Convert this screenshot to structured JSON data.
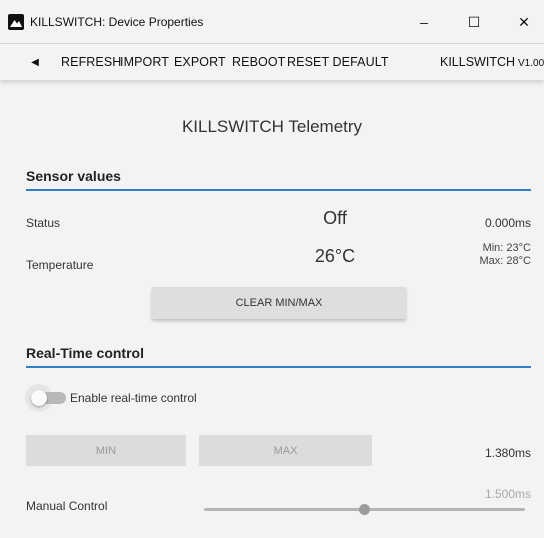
{
  "window": {
    "title": "KILLSWITCH: Device Properties",
    "app_icon": "mountain-logo-icon",
    "minimize_glyph": "–",
    "maximize_glyph": "☐",
    "close_glyph": "✕"
  },
  "toolbar": {
    "back_glyph": "◀",
    "refresh": "REFRESH",
    "import": "IMPORT",
    "export": "EXPORT",
    "reboot": "REBOOT",
    "reset_default": "RESET DEFAULT",
    "brand": "KILLSWITCH",
    "version": "V1.00"
  },
  "page": {
    "title": "KILLSWITCH Telemetry"
  },
  "sensor": {
    "heading": "Sensor values",
    "status_label": "Status",
    "status_value": "Off",
    "status_time": "0.000ms",
    "temp_label": "Temperature",
    "temp_value": "26°C",
    "temp_min": "Min: 23°C",
    "temp_max": "Max: 28°C",
    "clear_button": "CLEAR MIN/MAX"
  },
  "realtime": {
    "heading": "Real-Time control",
    "toggle_label": "Enable real-time control",
    "toggle_on": false,
    "min_button": "MIN",
    "max_button": "MAX",
    "time_value": "1.380ms",
    "manual_label": "Manual Control",
    "slider_value": "1.500ms"
  },
  "colors": {
    "accent": "#2f80c8",
    "background": "#f3f3f3"
  }
}
